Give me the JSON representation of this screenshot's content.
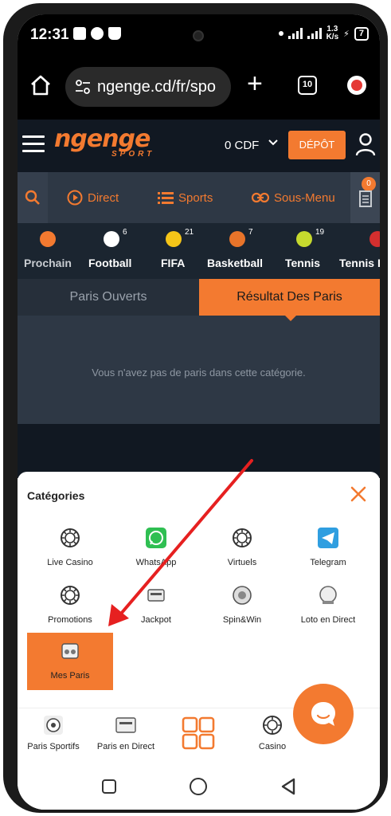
{
  "status_bar": {
    "time": "12:31",
    "speed_top": "1.3",
    "speed_unit": "K/s",
    "battery": "7"
  },
  "browser": {
    "url": "ngenge.cd/fr/spo",
    "tab_count": "10"
  },
  "header": {
    "logo_text": "ngenge",
    "logo_sub": "SPORT",
    "currency": "0 CDF",
    "deposit_label": "DÉPÔT"
  },
  "nav": {
    "direct": "Direct",
    "sports": "Sports",
    "submenu": "Sous-Menu",
    "betslip_count": "0"
  },
  "sports": [
    {
      "label": "Prochain",
      "count": "",
      "icon": "clock-icon",
      "color": "#f37a30"
    },
    {
      "label": "Football",
      "count": "6",
      "icon": "soccer-ball-icon",
      "color": "#ffffff"
    },
    {
      "label": "FIFA",
      "count": "21",
      "icon": "fifa-icon",
      "color": "#f5c518"
    },
    {
      "label": "Basketball",
      "count": "7",
      "icon": "basketball-icon",
      "color": "#e8742a"
    },
    {
      "label": "Tennis",
      "count": "19",
      "icon": "tennis-ball-icon",
      "color": "#c6d92e"
    },
    {
      "label": "Tennis I",
      "count": "",
      "icon": "table-tennis-icon",
      "color": "#d32f2f"
    }
  ],
  "bets": {
    "tab_open": "Paris Ouverts",
    "tab_results": "Résultat Des Paris",
    "empty_message": "Vous n'avez pas de paris dans cette catégorie."
  },
  "categories": {
    "title": "Catégories",
    "items": [
      {
        "label": "Live Casino",
        "icon": "casino-chip-icon"
      },
      {
        "label": "WhatsApp",
        "icon": "whatsapp-icon"
      },
      {
        "label": "Virtuels",
        "icon": "casino-chip-icon"
      },
      {
        "label": "Telegram",
        "icon": "telegram-icon"
      },
      {
        "label": "Promotions",
        "icon": "casino-chip-icon"
      },
      {
        "label": "Jackpot",
        "icon": "jackpot-icon"
      },
      {
        "label": "Spin&Win",
        "icon": "roulette-icon"
      },
      {
        "label": "Loto en Direct",
        "icon": "lottery-icon"
      },
      {
        "label": "Mes Paris",
        "icon": "my-bets-icon"
      }
    ]
  },
  "bottom_nav": {
    "sports": "Paris Sportifs",
    "live": "Paris en Direct",
    "casino": "Casino"
  },
  "colors": {
    "accent": "#f37a30",
    "header_bg": "#111822",
    "nav_bg": "#2e3845",
    "annotation_arrow": "#e62020"
  }
}
